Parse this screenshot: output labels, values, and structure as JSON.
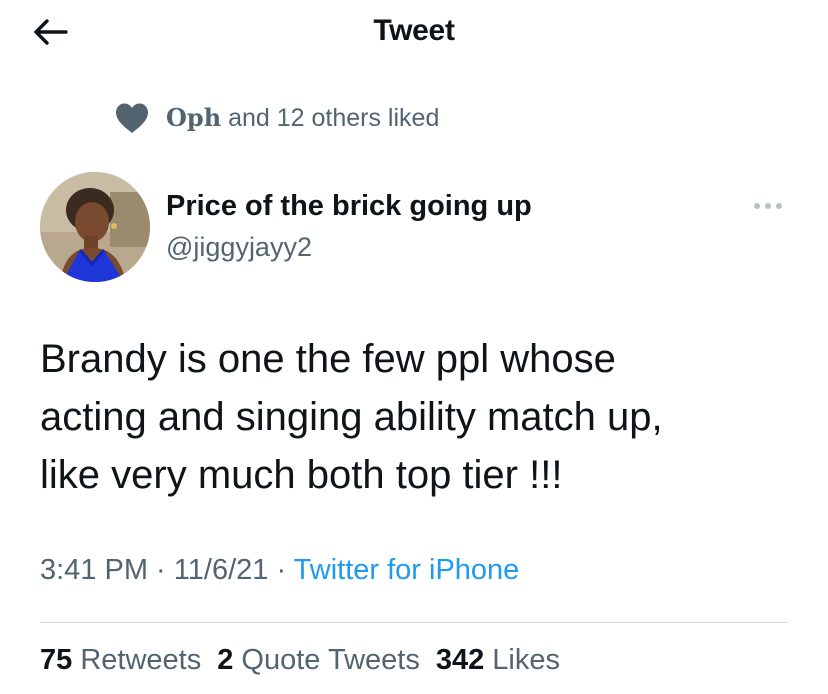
{
  "header": {
    "title": "Tweet",
    "back_icon": "arrow-left-icon"
  },
  "social_context": {
    "icon": "heart-icon",
    "name": "Oph",
    "rest": " and 12 others liked"
  },
  "author": {
    "display_name": "Price of the brick going up",
    "handle": "@jiggyjayy2",
    "more_icon": "more-dots-icon"
  },
  "tweet": {
    "line1": "Brandy is one the few ppl whose",
    "line2": "acting and singing ability match up,",
    "line3": "like very much both top tier !!!"
  },
  "meta": {
    "time": "3:41 PM",
    "sep1": " · ",
    "date": "11/6/21",
    "sep2": " · ",
    "source": "Twitter for iPhone"
  },
  "stats": {
    "retweets_count": "75",
    "retweets_label": "Retweets",
    "quotes_count": "2",
    "quotes_label": "Quote Tweets",
    "likes_count": "342",
    "likes_label": "Likes"
  },
  "colors": {
    "text": "#0f1419",
    "secondary": "#536471",
    "link": "#1d9bf0",
    "divider": "#d4d9dd"
  }
}
